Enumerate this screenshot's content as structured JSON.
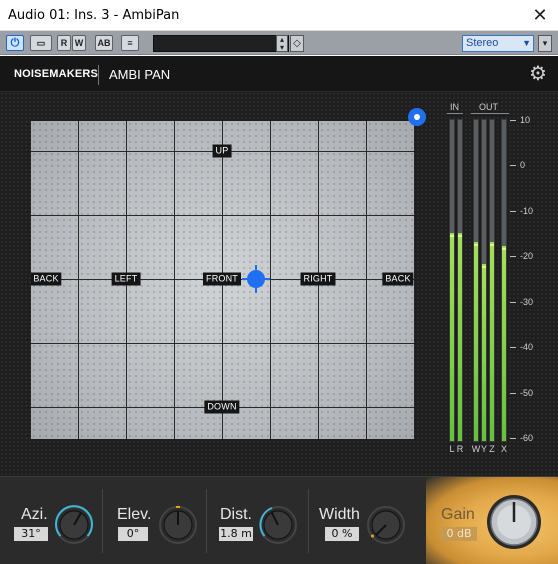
{
  "window": {
    "title": "Audio 01: Ins. 3 - AmbiPan",
    "close_glyph": "✕"
  },
  "toolbar": {
    "power_icon": "power-icon",
    "buttons": [
      {
        "name": "compare-button",
        "label": "▭"
      },
      {
        "name": "read-button",
        "label": "R"
      },
      {
        "name": "write-button",
        "label": "W"
      },
      {
        "name": "ab-button",
        "label": "AB"
      },
      {
        "name": "menu-button",
        "label": "≡"
      }
    ],
    "preset_value": "",
    "output_format": "Stereo"
  },
  "header": {
    "brand": "NOISEMAKERS",
    "product": "AMBI PAN",
    "settings_icon": "gear-icon"
  },
  "pad": {
    "labels": {
      "up": "UP",
      "down": "DOWN",
      "back_left": "BACK",
      "left": "LEFT",
      "front": "FRONT",
      "right": "RIGHT",
      "back_right": "BACK"
    },
    "accent_color": "#1f6ff0"
  },
  "meters": {
    "in_label": "IN",
    "out_label": "OUT",
    "channels": [
      {
        "name": "L",
        "level_db": -15
      },
      {
        "name": "R",
        "level_db": -15
      },
      {
        "name": "W",
        "level_db": -17
      },
      {
        "name": "Y",
        "level_db": -22
      },
      {
        "name": "Z",
        "level_db": -17
      },
      {
        "name": "X",
        "level_db": -18
      }
    ],
    "scale": [
      "10",
      "0",
      "-10",
      "-20",
      "-30",
      "-40",
      "-50",
      "-60"
    ]
  },
  "controls": {
    "azimuth": {
      "label": "Azi.",
      "value": "31°"
    },
    "elevation": {
      "label": "Elev.",
      "value": "0°"
    },
    "distance": {
      "label": "Dist.",
      "value": "1.8 m"
    },
    "width": {
      "label": "Width",
      "value": "0 %"
    },
    "gain": {
      "label": "Gain",
      "value": "0 dB"
    }
  }
}
